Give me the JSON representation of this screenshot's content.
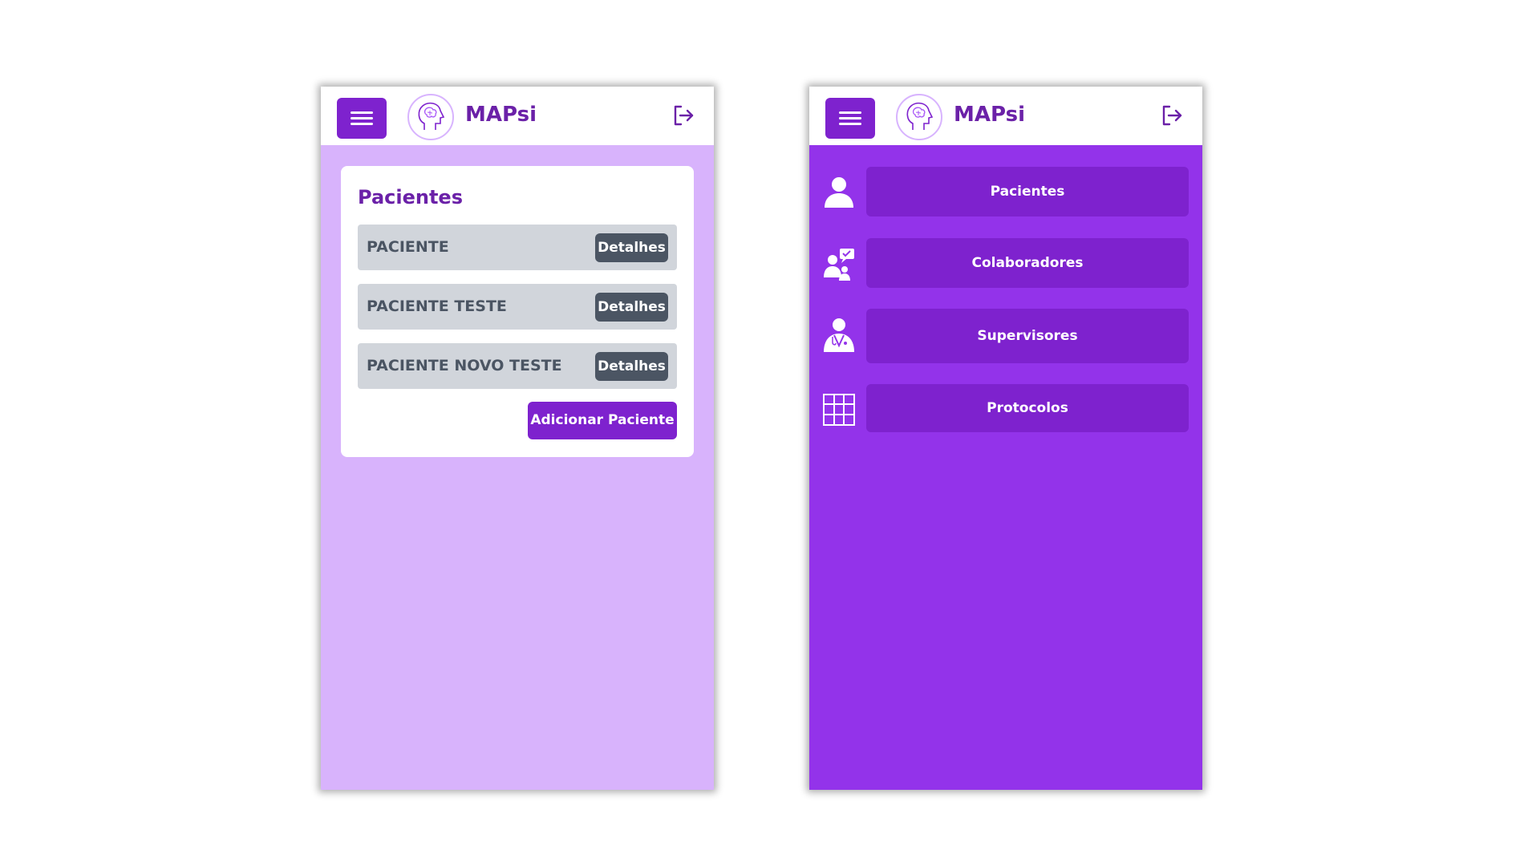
{
  "colors": {
    "brand_purple": "#7e22ce",
    "title_purple": "#6b21a8",
    "left_background": "#d8b3fc",
    "right_background": "#9333ea",
    "row_gray": "#d1d5db",
    "detail_button": "#4b5563"
  },
  "header": {
    "app_title": "MAPsi",
    "menu_icon": "hamburger-icon",
    "logo_icon": "brain-head-logo-icon",
    "logout_icon": "logout-icon"
  },
  "patients_screen": {
    "title": "Pacientes",
    "patients": [
      {
        "name": "PACIENTE",
        "action": "Detalhes"
      },
      {
        "name": "PACIENTE TESTE",
        "action": "Detalhes"
      },
      {
        "name": "PACIENTE NOVO TESTE",
        "action": "Detalhes"
      }
    ],
    "add_button": "Adicionar Paciente"
  },
  "menu_screen": {
    "items": [
      {
        "label": "Pacientes",
        "icon": "user-icon"
      },
      {
        "label": "Colaboradores",
        "icon": "collaborators-chat-icon"
      },
      {
        "label": "Supervisores",
        "icon": "doctor-icon"
      },
      {
        "label": "Protocolos",
        "icon": "table-grid-icon"
      }
    ]
  }
}
